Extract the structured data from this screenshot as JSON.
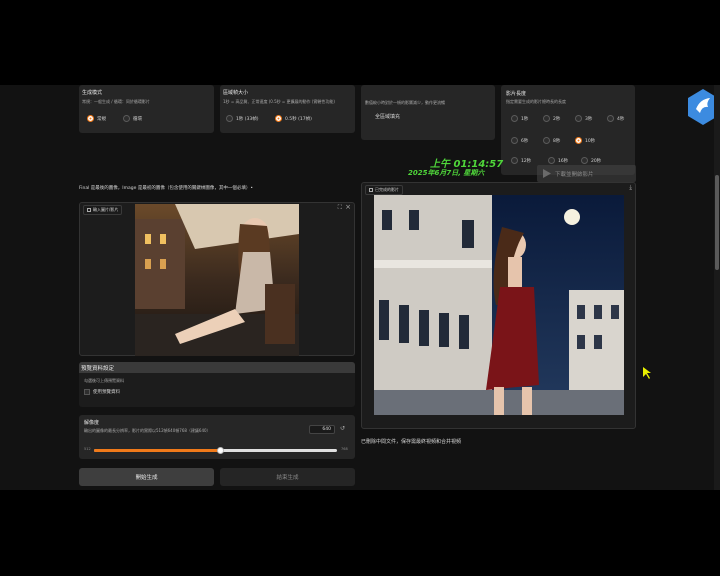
{
  "mode_panel": {
    "title": "生成模式",
    "desc": "常規：一般生成 / 循環：同於循環影片",
    "options": [
      "常規",
      "循環"
    ],
    "selected": "常規"
  },
  "window_panel": {
    "title": "區域幀大小",
    "desc": "1秒 = 高品質、正常速度 (0.5秒 = 更擴展的動作 (實驗性功能)",
    "options": [
      "1秒 (33幀)",
      "0.5秒 (17幀)"
    ],
    "selected": "0.5秒 (17幀)"
  },
  "section_panel": {
    "desc": "數值較小時對於一幀的影響減少，動作更流暢",
    "value": "全區域填充"
  },
  "length_panel": {
    "title": "影片長度",
    "desc": "指定需要生成的影片總時長的長度",
    "options": [
      "1秒",
      "2秒",
      "3秒",
      "4秒",
      "6秒",
      "8秒",
      "10秒",
      "12秒",
      "16秒",
      "20秒"
    ],
    "selected": "10秒"
  },
  "clock": {
    "time": "上午 01:14:57",
    "date": "2025年6月7日, 星期六"
  },
  "final_label": "Final 是最後的圖像，Image 是最初的圖像（包含使用的關鍵幀圖像，其中一個必填）•",
  "input_image": {
    "label": "輸入圖片/影片"
  },
  "output_video": {
    "label": "已完成的影片"
  },
  "history": {
    "title": "預覽資料設定",
    "desc": "勾選後可上傳預覽資料",
    "checkbox": "使用預覽資料"
  },
  "resolution": {
    "title": "解像度",
    "desc": "輸出的圖像的最長分辨率，影片的實際以512幀640幀768（建議640）",
    "value": "640",
    "min": "512",
    "max": "768",
    "fraction": 0.52
  },
  "buttons": {
    "start": "開始生成",
    "stop": "結束生成"
  },
  "status_text": "已刪除中間文件，保存需最終視頻和合并視頻",
  "overlay_watermark": "下載並開啟影片",
  "colors": {
    "accent": "#f07a1a",
    "clock": "#4fd63a",
    "logo": "#3c8be0"
  }
}
